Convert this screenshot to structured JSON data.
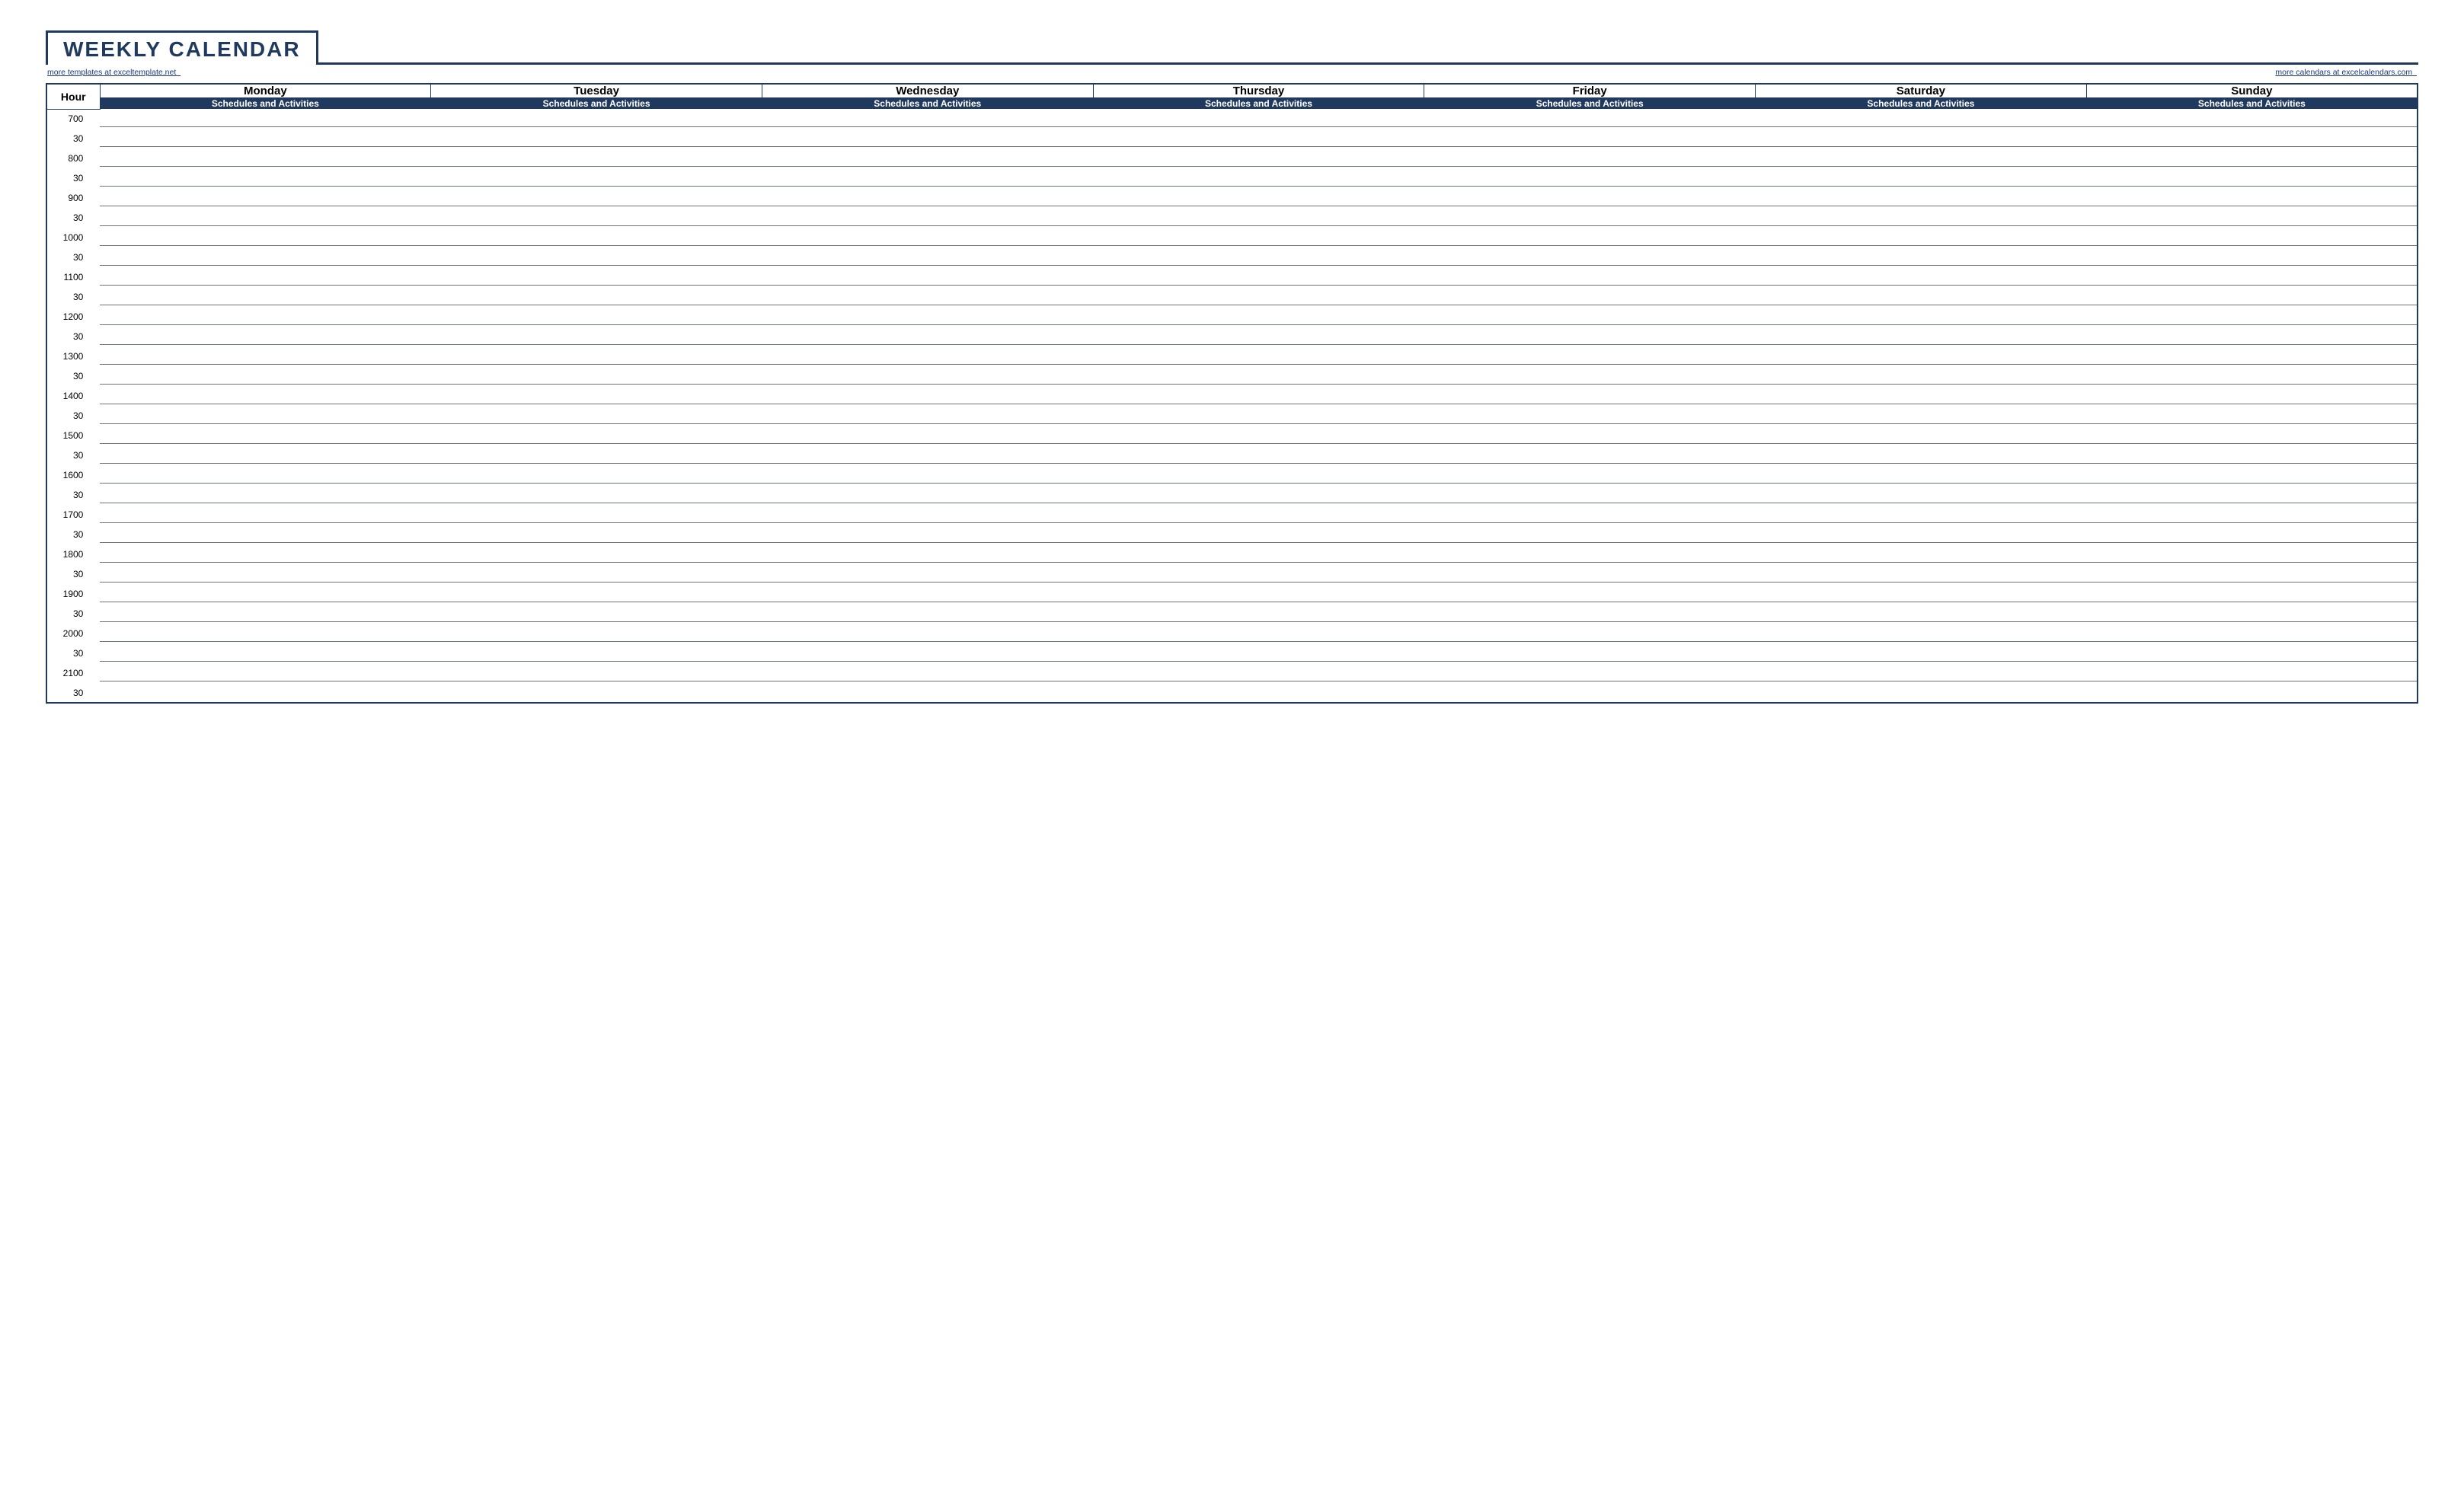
{
  "title": "WEEKLY CALENDAR",
  "links": {
    "left": "more templates at exceltemplate.net  ",
    "right": "more calendars at excelcalendars.com  "
  },
  "table": {
    "hour_header": "Hour",
    "days": [
      "Monday",
      "Tuesday",
      "Wednesday",
      "Thursday",
      "Friday",
      "Saturday",
      "Sunday"
    ],
    "sub_header": "Schedules and Activities",
    "hours": [
      {
        "h": "7",
        "m": "00"
      },
      {
        "h": "",
        "m": "30"
      },
      {
        "h": "8",
        "m": "00"
      },
      {
        "h": "",
        "m": "30"
      },
      {
        "h": "9",
        "m": "00"
      },
      {
        "h": "",
        "m": "30"
      },
      {
        "h": "10",
        "m": "00"
      },
      {
        "h": "",
        "m": "30"
      },
      {
        "h": "11",
        "m": "00"
      },
      {
        "h": "",
        "m": "30"
      },
      {
        "h": "12",
        "m": "00"
      },
      {
        "h": "",
        "m": "30"
      },
      {
        "h": "13",
        "m": "00"
      },
      {
        "h": "",
        "m": "30"
      },
      {
        "h": "14",
        "m": "00"
      },
      {
        "h": "",
        "m": "30"
      },
      {
        "h": "15",
        "m": "00"
      },
      {
        "h": "",
        "m": "30"
      },
      {
        "h": "16",
        "m": "00"
      },
      {
        "h": "",
        "m": "30"
      },
      {
        "h": "17",
        "m": "00"
      },
      {
        "h": "",
        "m": "30"
      },
      {
        "h": "18",
        "m": "00"
      },
      {
        "h": "",
        "m": "30"
      },
      {
        "h": "19",
        "m": "00"
      },
      {
        "h": "",
        "m": "30"
      },
      {
        "h": "20",
        "m": "00"
      },
      {
        "h": "",
        "m": "30"
      },
      {
        "h": "21",
        "m": "00"
      },
      {
        "h": "",
        "m": "30"
      }
    ]
  }
}
